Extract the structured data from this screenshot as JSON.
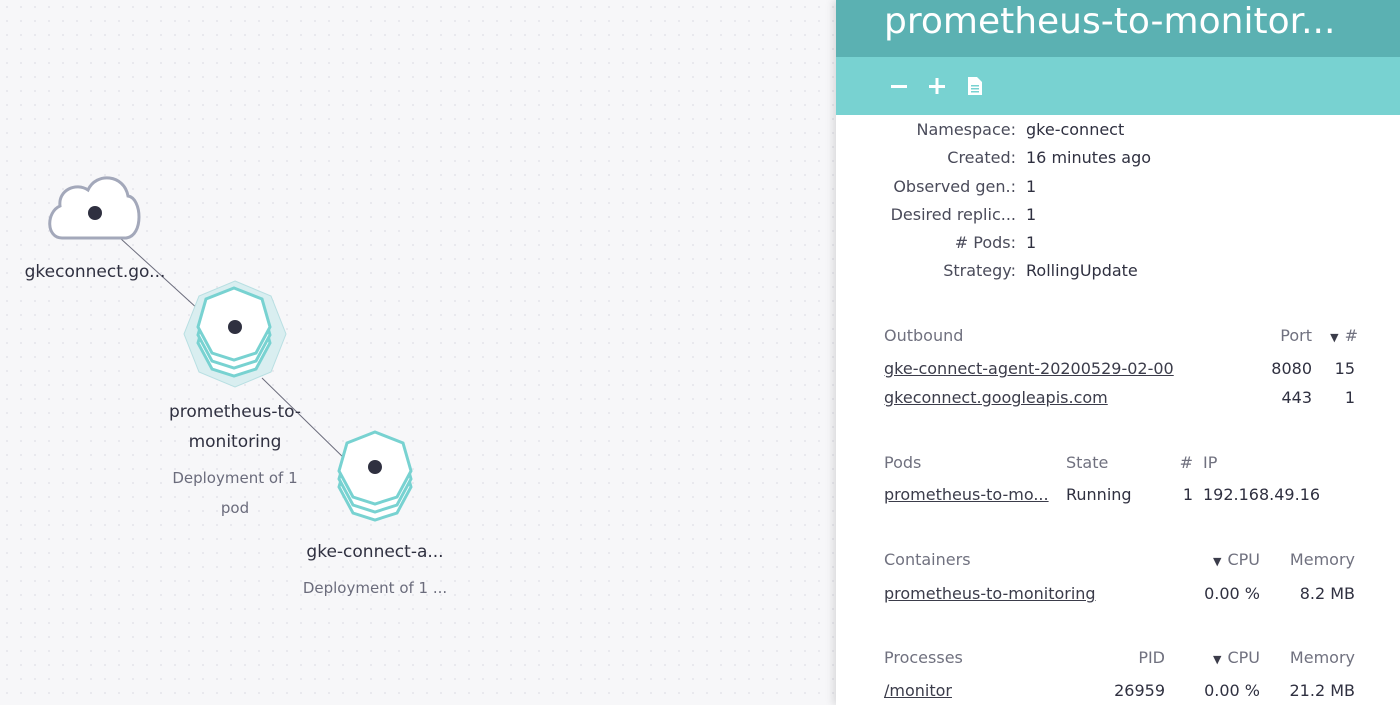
{
  "graph": {
    "nodes": [
      {
        "label": "gkeconnect.go...",
        "sublabel": ""
      },
      {
        "label": "prometheus-to-",
        "label2": "monitoring",
        "sublabel": "Deployment of 1",
        "sublabel2": "pod"
      },
      {
        "label": "gke-connect-a...",
        "sublabel": "Deployment of 1 ..."
      }
    ],
    "colors": {
      "accent": "#78d2d1",
      "node_center": "#2f3040",
      "cloud": "#9aa0b4"
    }
  },
  "panel": {
    "title": "prometheus-to-monitor...",
    "toolbar": {
      "zoom_out_icon": "minus-icon",
      "zoom_in_icon": "plus-icon",
      "doc_icon": "document-icon"
    },
    "info": [
      {
        "key": "Namespace:",
        "value": "gke-connect"
      },
      {
        "key": "Created:",
        "value": "16 minutes ago"
      },
      {
        "key": "Observed gen.:",
        "value": "1"
      },
      {
        "key": "Desired replic...",
        "value": "1"
      },
      {
        "key": "# Pods:",
        "value": "1"
      },
      {
        "key": "Strategy:",
        "value": "RollingUpdate"
      }
    ],
    "outbound": {
      "header": "Outbound",
      "col_port": "Port",
      "col_count": "#",
      "rows": [
        {
          "name": "gke-connect-agent-20200529-02-00",
          "port": "8080",
          "count": "15"
        },
        {
          "name": "gkeconnect.googleapis.com",
          "port": "443",
          "count": "1"
        }
      ]
    },
    "pods": {
      "header": "Pods",
      "col_state": "State",
      "col_count": "#",
      "col_ip": "IP",
      "rows": [
        {
          "name": "prometheus-to-mo...",
          "state": "Running",
          "count": "1",
          "ip": "192.168.49.16"
        }
      ]
    },
    "containers": {
      "header": "Containers",
      "col_cpu": "CPU",
      "col_memory": "Memory",
      "rows": [
        {
          "name": "prometheus-to-monitoring",
          "cpu": "0.00 %",
          "memory": "8.2 MB"
        }
      ]
    },
    "processes": {
      "header": "Processes",
      "col_pid": "PID",
      "col_cpu": "CPU",
      "col_memory": "Memory",
      "rows": [
        {
          "name": "/monitor",
          "pid": "26959",
          "cpu": "0.00 %",
          "memory": "21.2 MB"
        }
      ]
    },
    "caret": "▼"
  }
}
